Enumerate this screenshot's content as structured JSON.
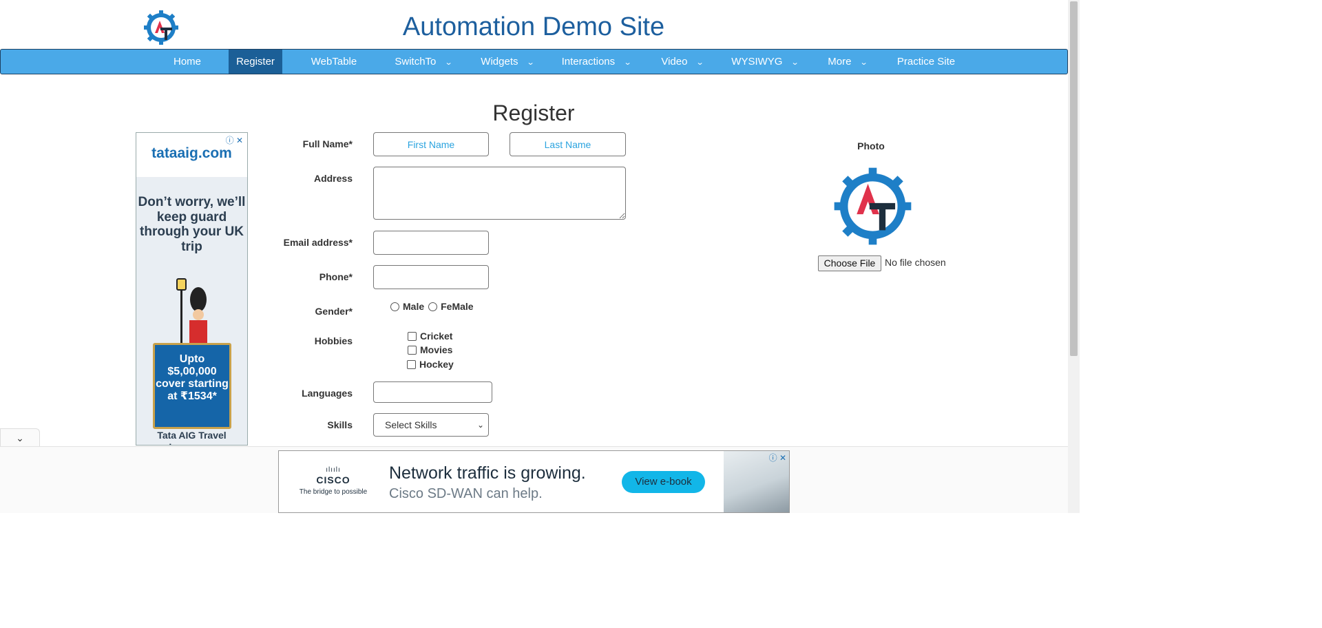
{
  "header": {
    "site_title": "Automation Demo Site",
    "logo_icon": "automation-gear-logo"
  },
  "nav": {
    "items": [
      {
        "label": "Home",
        "dropdown": false
      },
      {
        "label": "Register",
        "dropdown": false,
        "active": true
      },
      {
        "label": "WebTable",
        "dropdown": false
      },
      {
        "label": "SwitchTo",
        "dropdown": true
      },
      {
        "label": "Widgets",
        "dropdown": true
      },
      {
        "label": "Interactions",
        "dropdown": true
      },
      {
        "label": "Video",
        "dropdown": true
      },
      {
        "label": "WYSIWYG",
        "dropdown": true
      },
      {
        "label": "More",
        "dropdown": true
      },
      {
        "label": "Practice Site",
        "dropdown": false
      }
    ],
    "chevron": "⌄"
  },
  "page": {
    "heading": "Register"
  },
  "form": {
    "full_name_label": "Full Name*",
    "first_name_placeholder": "First Name",
    "last_name_placeholder": "Last Name",
    "address_label": "Address",
    "email_label": "Email address*",
    "phone_label": "Phone*",
    "gender_label": "Gender*",
    "gender_male": "Male",
    "gender_female": "FeMale",
    "hobbies_label": "Hobbies",
    "hobby_cricket": "Cricket",
    "hobby_movies": "Movies",
    "hobby_hockey": "Hockey",
    "languages_label": "Languages",
    "skills_label": "Skills",
    "skills_selected": "Select Skills"
  },
  "photo": {
    "label": "Photo",
    "choose_file": "Choose File",
    "file_status": "No file chosen"
  },
  "ad_left": {
    "brand": "tataaig.com",
    "copy": "Don’t worry, we’ll keep guard through your UK trip",
    "offer": "Upto $5,00,000 cover starting at ₹1534*",
    "footer": "Tata AIG Travel Insurance"
  },
  "ad_bottom": {
    "brand": "CISCO",
    "brand_bars": "ılıılı",
    "tagline": "The bridge to possible",
    "headline": "Network traffic is growing.",
    "subline": "Cisco SD-WAN can help.",
    "cta": "View e-book"
  },
  "colors": {
    "nav_bg": "#4aa9e8",
    "nav_active": "#1b5f97",
    "title": "#1d5f9e",
    "placeholder": "#2aa3df"
  }
}
